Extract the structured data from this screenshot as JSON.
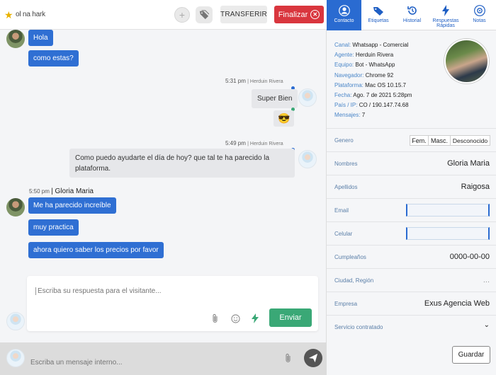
{
  "header": {
    "contact_name": "ol na hark",
    "transfer_label": "TRANSFERIR",
    "finish_label": "Finalizar"
  },
  "chat": {
    "messages": [
      {
        "text": "Hola"
      },
      {
        "text": "como estas?"
      },
      {
        "meta_time": "5:31 pm",
        "meta_agent": "| Herduin Rivera",
        "text": "Super Bien"
      },
      {
        "emoji": "😎"
      },
      {
        "meta_time": "5:49 pm",
        "meta_agent": "| Herduin Rivera",
        "text": "Como puedo ayudarte el día de hoy? que tal te ha parecido la plataforma."
      },
      {
        "meta_time": "5:50 pm",
        "meta_name": "| Gloria Maria",
        "text": "Me ha parecido increíble"
      },
      {
        "text": "muy practica"
      },
      {
        "text": "ahora quiero saber los precios por favor"
      }
    ]
  },
  "reply": {
    "placeholder": "Escriba su respuesta para el visitante...",
    "send_label": "Enviar"
  },
  "internal": {
    "placeholder": "Escriba un mensaje interno..."
  },
  "tabs": [
    {
      "label": "Contacto"
    },
    {
      "label": "Etiquetas"
    },
    {
      "label": "Historial"
    },
    {
      "label": "Respuestas Rápidas"
    },
    {
      "label": "Notas"
    }
  ],
  "info": [
    {
      "k": "Canal:",
      "v": "Whatsapp - Comercial"
    },
    {
      "k": "Agente:",
      "v": "Herduin Rivera"
    },
    {
      "k": "Equipo:",
      "v": "Bot - WhatsApp"
    },
    {
      "k": "Navegador:",
      "v": "Chrome 92"
    },
    {
      "k": "Plataforma:",
      "v": "Mac OS 10.15.7"
    },
    {
      "k": "Fecha:",
      "v": "Ago. 7 de 2021 5:28pm"
    },
    {
      "k": "País / IP:",
      "v": "CO / 190.147.74.68"
    },
    {
      "k": "Mensajes:",
      "v": "7"
    }
  ],
  "form": {
    "genero_label": "Genero",
    "gender_options": [
      "Fem.",
      "Masc.",
      "Desconocido"
    ],
    "nombres_label": "Nombres",
    "nombres_value": "Gloria Maria",
    "apellidos_label": "Apellidos",
    "apellidos_value": "Raigosa",
    "email_label": "Email",
    "celular_label": "Celular",
    "cumple_label": "Cumpleaños",
    "cumple_value": "0000-00-00",
    "ciudad_label": "Ciudad, Región",
    "ciudad_value": "...",
    "empresa_label": "Empresa",
    "empresa_value": "Exus Agencia Web",
    "servicio_label": "Servicio contratado",
    "save_label": "Guardar"
  },
  "colors": {
    "accent": "#2a6bd1",
    "customer_bubble": "#2f6fd3",
    "finish": "#d9363e",
    "send": "#3aa876"
  }
}
